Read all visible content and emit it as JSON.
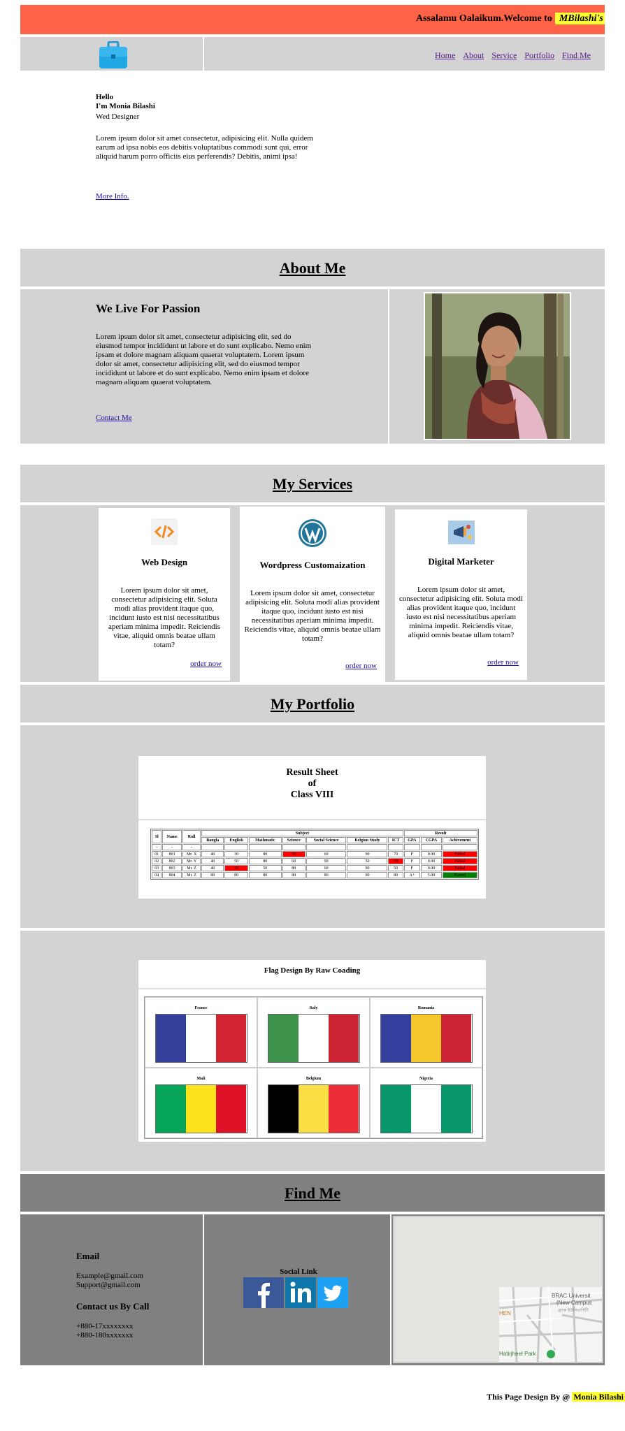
{
  "banner": {
    "text": "Assalamu Oalaikum.Welcome to",
    "highlight": "MBilashi's We"
  },
  "nav": {
    "links": [
      "Home",
      "About",
      "Service",
      "Portfolio",
      "Find Me"
    ]
  },
  "hero": {
    "hello": "Hello",
    "name": "I'm Monia Bilashi",
    "role": "Wed Designer",
    "body": "Lorem ipsum dolor sit amet consectetur, adipisicing elit. Nulla quidem earum ad ipsa nobis eos debitis voluptatibus commodi sunt qui, error aliquid harum porro officiis eius perferendis? Debitis, animi ipsa!",
    "more": "More Info."
  },
  "about": {
    "heading": "About Me",
    "subheading": "We Live For Passion",
    "body": "Lorem ipsum dolor sit amet, consectetur adipisicing elit, sed do eiusmod tempor incididunt ut labore et do sunt explicabo. Nemo enim ipsam et dolore magnam aliquam quaerat voluptatem. Lorem ipsum dolor sit amet, consectetur adipisicing elit, sed do eiusmod tempor incididunt ut labore et do sunt explicabo. Nemo enim ipsam et dolore magnam aliquam quaerat voluptatem.",
    "contact": "Contact Me"
  },
  "services": {
    "heading": "My Services",
    "order": "order now",
    "cards": [
      {
        "title": "Web Design",
        "body": "Lorem ipsum dolor sit amet, consectetur adipisicing elit. Soluta modi alias provident itaque quo, incidunt iusto est nisi necessitatibus aperiam minima impedit. Reiciendis vitae, aliquid omnis beatae ullam totam?"
      },
      {
        "title": "Wordpress Customaization",
        "body": "Lorem ipsum dolor sit amet, consectetur adipisicing elit. Soluta modi alias provident itaque quo, incidunt iusto est nisi necessitatibus aperiam minima impedit. Reiciendis vitae, aliquid omnis beatae ullam totam?"
      },
      {
        "title": "Digital Marketer",
        "body": "Lorem ipsum dolor sit amet, consectetur adipisicing elit. Soluta modi alias provident itaque quo, incidunt iusto est nisi necessitatibus aperiam minima impedit. Reiciendis vitae, aliquid omnis beatae ullam totam?"
      }
    ]
  },
  "portfolio": {
    "heading": "My Portfolio",
    "sheet": {
      "line1": "Result Sheet",
      "line2": "of",
      "line3": "Class VIII",
      "group_subject": "Subject",
      "group_result": "Result",
      "headers": [
        "Sl",
        "Name",
        "Roll",
        "Bangla",
        "English",
        "Mathmatic",
        "Science",
        "Social Science",
        "Relgion Study",
        "ICT",
        "GPA",
        "CGPA",
        "Achivement"
      ],
      "rows": [
        [
          "-",
          "-",
          "-",
          "",
          "",
          "",
          "",
          "",
          "",
          "",
          "",
          "",
          ""
        ],
        [
          "01",
          "801",
          "Mr. X",
          "40",
          "30",
          "80",
          "30",
          "60",
          "90",
          "70",
          "F",
          "0.00",
          "Failed"
        ],
        [
          "02",
          "802",
          "Mr. Y",
          "40",
          "50",
          "80",
          "60",
          "90",
          "50",
          "30",
          "F",
          "0.00",
          "Failed"
        ],
        [
          "03",
          "803",
          "Mr. Z",
          "40",
          "30",
          "50",
          "80",
          "60",
          "90",
          "50",
          "F",
          "0.00",
          "Failed"
        ],
        [
          "04",
          "804",
          "Mr. Z",
          "80",
          "80",
          "80",
          "80",
          "80",
          "90",
          "80",
          "A+",
          "5.00",
          "Passed"
        ]
      ]
    },
    "flags": {
      "title": "Flag Design By Raw Coading",
      "items": [
        {
          "name": "France",
          "colors": [
            "#343f9b",
            "#ffffff",
            "#d12531"
          ]
        },
        {
          "name": "Italy",
          "colors": [
            "#3d944a",
            "#ffffff",
            "#cc2333"
          ]
        },
        {
          "name": "Romania",
          "colors": [
            "#333f9c",
            "#f4c72c",
            "#cb2334"
          ]
        },
        {
          "name": "Mali",
          "colors": [
            "#07a557",
            "#fbe21b",
            "#df1227"
          ]
        },
        {
          "name": "Belgium",
          "colors": [
            "#000000",
            "#f9df43",
            "#ec2c37"
          ]
        },
        {
          "name": "Nigeria",
          "colors": [
            "#07976a",
            "#ffffff",
            "#07976a"
          ]
        }
      ]
    }
  },
  "find": {
    "heading": "Find Me",
    "email_h": "Email",
    "email1": "Example@gmail.com",
    "email2": "Support@gmail.com",
    "call_h": "Contact us By Call",
    "phone1": "+880-17xxxxxxxx",
    "phone2": "+880-180xxxxxxx",
    "social_h": "Social Link",
    "map": {
      "label1": "BRAC Universit",
      "label2": "(New Campus",
      "label3": "ব্র্যাক ইউনিভার্সিটি",
      "label4": "Hatirjheel Park",
      "label5": "HEN"
    }
  },
  "footer": {
    "text": "This Page Design By @",
    "name": "Monia Bilashi"
  },
  "colors": {
    "banner": "#ff6347",
    "panel": "#d3d3d3",
    "find": "#808080",
    "highlight": "#ffff33",
    "linkedin": "#0e76a8",
    "facebook": "#3b5998",
    "twitter": "#1da1f2"
  }
}
